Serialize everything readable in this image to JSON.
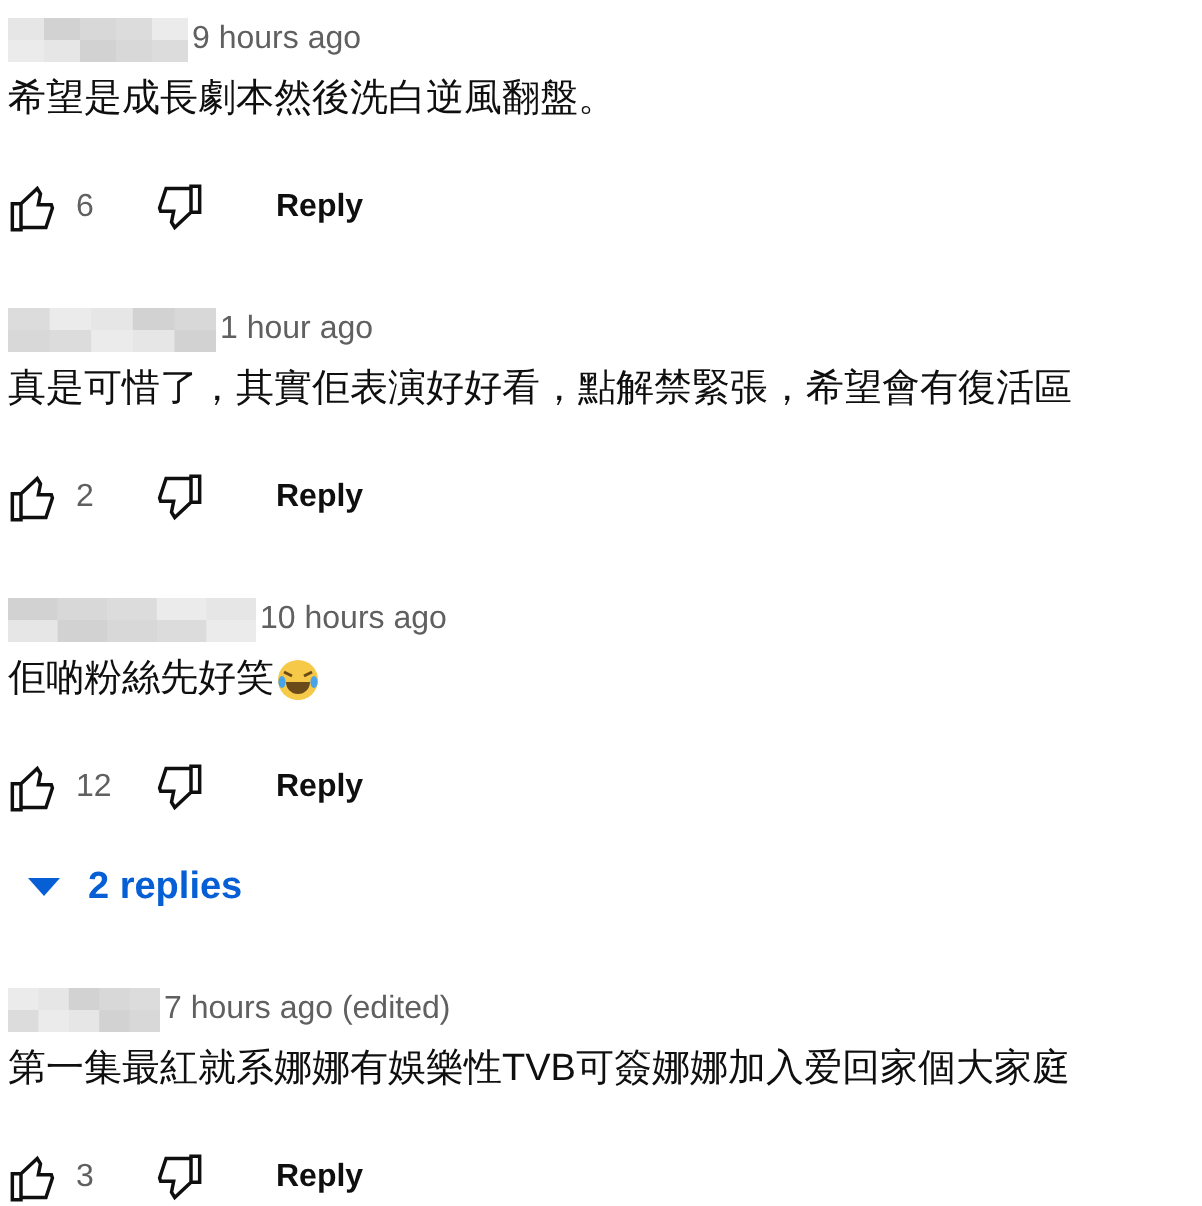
{
  "comments": [
    {
      "time": "9 hours ago",
      "text": "希望是成長劇本然後洗白逆風翻盤。",
      "likes": "6",
      "reply": "Reply"
    },
    {
      "time": "1 hour ago",
      "text": "真是可惜了，其實佢表演好好看，點解禁緊張，希望會有復活區",
      "likes": "2",
      "reply": "Reply"
    },
    {
      "time": "10 hours ago",
      "text": "佢啲粉絲先好笑",
      "emoji": true,
      "likes": "12",
      "reply": "Reply",
      "replies": "2 replies"
    },
    {
      "time": "7 hours ago (edited)",
      "text": "第一集最紅就系娜娜有娛樂性TVB可簽娜娜加入爱回家個大家庭",
      "likes": "3",
      "reply": "Reply"
    }
  ]
}
